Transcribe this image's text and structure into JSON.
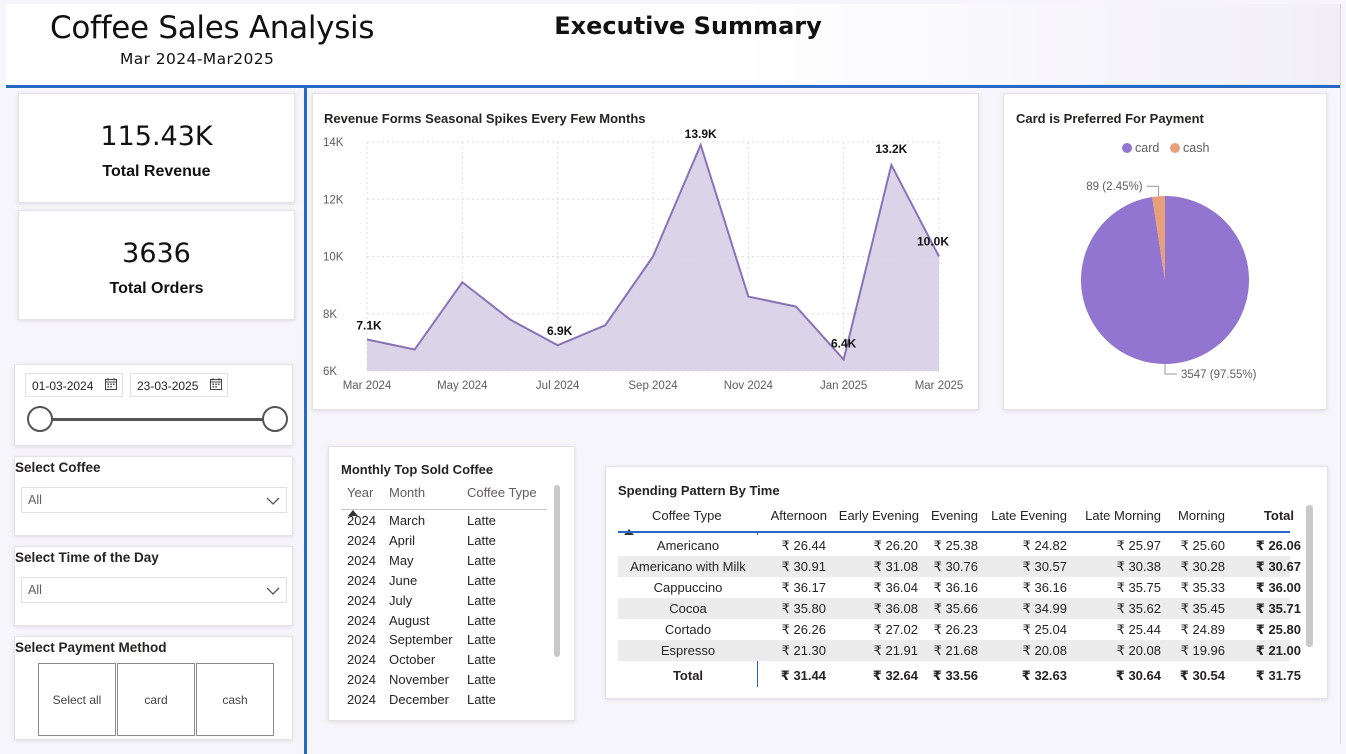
{
  "header": {
    "app_title": "Coffee Sales Analysis",
    "app_subtitle": "Mar 2024-Mar2025",
    "page_title": "Executive Summary"
  },
  "kpis": {
    "revenue": {
      "value": "115.43K",
      "label": "Total Revenue"
    },
    "orders": {
      "value": "3636",
      "label": "Total Orders"
    }
  },
  "filters": {
    "date_start": "01-03-2024",
    "date_end": "23-03-2025",
    "coffee": {
      "title": "Select Coffee",
      "value": "All"
    },
    "time_of_day": {
      "title": "Select Time of the Day",
      "value": "All"
    },
    "payment": {
      "title": "Select Payment Method",
      "options": [
        "Select all",
        "card",
        "cash"
      ]
    }
  },
  "colors": {
    "accent_blue": "#2767c6",
    "series_purple": "#8a72b8",
    "area_fill": "#d7cfe6",
    "card_slice": "#9175d0",
    "cash_slice": "#e8a07a"
  },
  "chart_data": [
    {
      "type": "area",
      "title": "Revenue Forms Seasonal Spikes Every Few Months",
      "x": [
        "Mar 2024",
        "Apr 2024",
        "May 2024",
        "Jun 2024",
        "Jul 2024",
        "Aug 2024",
        "Sep 2024",
        "Oct 2024",
        "Nov 2024",
        "Dec 2024",
        "Jan 2025",
        "Feb 2025",
        "Mar 2025"
      ],
      "x_tick_labels": [
        "Mar 2024",
        "May 2024",
        "Jul 2024",
        "Sep 2024",
        "Nov 2024",
        "Jan 2025",
        "Mar 2025"
      ],
      "values": [
        7100,
        6750,
        9100,
        7800,
        6900,
        7600,
        10000,
        13900,
        8600,
        8250,
        6400,
        13200,
        10000
      ],
      "data_labels": [
        {
          "index": 0,
          "text": "7.1K"
        },
        {
          "index": 4,
          "text": "6.9K"
        },
        {
          "index": 7,
          "text": "13.9K"
        },
        {
          "index": 10,
          "text": "6.4K"
        },
        {
          "index": 11,
          "text": "13.2K"
        },
        {
          "index": 12,
          "text": "10.0K"
        }
      ],
      "y_ticks": [
        "6K",
        "8K",
        "10K",
        "12K",
        "14K"
      ],
      "ylim": [
        6000,
        14000
      ],
      "grid": true
    },
    {
      "type": "pie",
      "title": "Card is Preferred For Payment",
      "legend": "top",
      "slices": [
        {
          "name": "card",
          "value": 3547,
          "label": "3547 (97.55%)"
        },
        {
          "name": "cash",
          "value": 89,
          "label": "89 (2.45%)"
        }
      ]
    }
  ],
  "top_sold": {
    "title": "Monthly Top Sold Coffee",
    "columns": [
      "Year",
      "Month",
      "Coffee Type"
    ],
    "rows": [
      [
        "2024",
        "March",
        "Latte"
      ],
      [
        "2024",
        "April",
        "Latte"
      ],
      [
        "2024",
        "May",
        "Latte"
      ],
      [
        "2024",
        "June",
        "Latte"
      ],
      [
        "2024",
        "July",
        "Latte"
      ],
      [
        "2024",
        "August",
        "Latte"
      ],
      [
        "2024",
        "September",
        "Latte"
      ],
      [
        "2024",
        "October",
        "Latte"
      ],
      [
        "2024",
        "November",
        "Latte"
      ],
      [
        "2024",
        "December",
        "Latte"
      ]
    ]
  },
  "spending": {
    "title": "Spending Pattern By Time",
    "columns": [
      "Coffee Type",
      "Afternoon",
      "Early Evening",
      "Evening",
      "Late Evening",
      "Late Morning",
      "Morning",
      "Total"
    ],
    "rows": [
      [
        "Americano",
        "₹ 26.44",
        "₹ 26.20",
        "₹ 25.38",
        "₹ 24.82",
        "₹ 25.97",
        "₹ 25.60",
        "₹ 26.06"
      ],
      [
        "Americano with Milk",
        "₹ 30.91",
        "₹ 31.08",
        "₹ 30.76",
        "₹ 30.57",
        "₹ 30.38",
        "₹ 30.28",
        "₹ 30.67"
      ],
      [
        "Cappuccino",
        "₹ 36.17",
        "₹ 36.04",
        "₹ 36.16",
        "₹ 36.16",
        "₹ 35.75",
        "₹ 35.33",
        "₹ 36.00"
      ],
      [
        "Cocoa",
        "₹ 35.80",
        "₹ 36.08",
        "₹ 35.66",
        "₹ 34.99",
        "₹ 35.62",
        "₹ 35.45",
        "₹ 35.71"
      ],
      [
        "Cortado",
        "₹ 26.26",
        "₹ 27.02",
        "₹ 26.23",
        "₹ 25.04",
        "₹ 25.44",
        "₹ 24.89",
        "₹ 25.80"
      ],
      [
        "Espresso",
        "₹ 21.30",
        "₹ 21.91",
        "₹ 21.68",
        "₹ 20.08",
        "₹ 20.08",
        "₹ 19.96",
        "₹ 21.00"
      ]
    ],
    "total": [
      "Total",
      "₹ 31.44",
      "₹ 32.64",
      "₹ 33.56",
      "₹ 32.63",
      "₹ 30.64",
      "₹ 30.54",
      "₹ 31.75"
    ]
  }
}
